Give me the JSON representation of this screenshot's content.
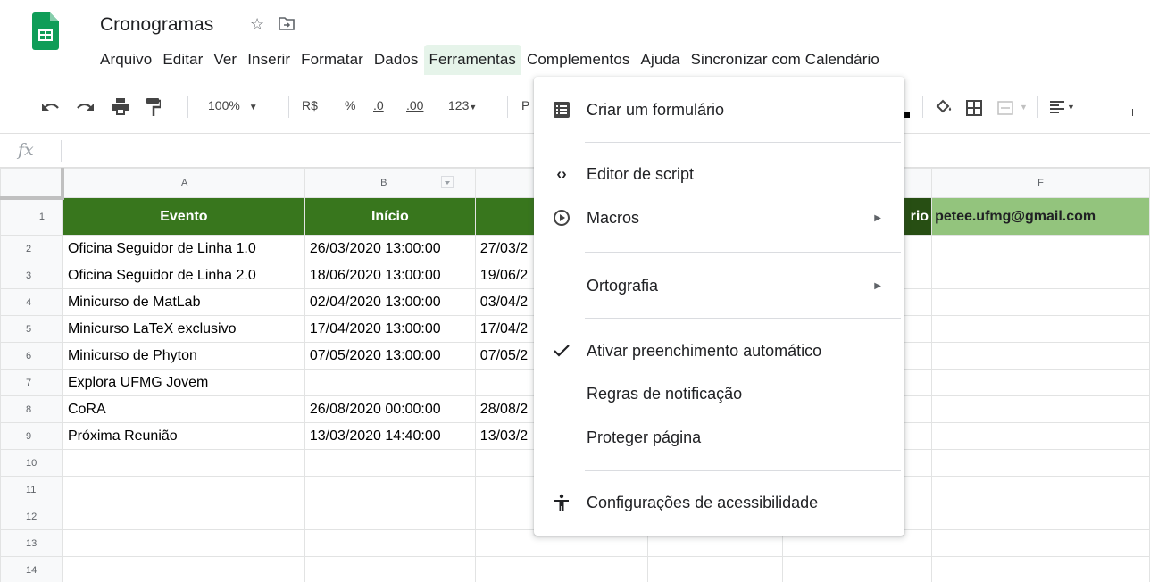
{
  "app": {
    "doc_title": "Cronogramas",
    "brand_color": "#0f9d58"
  },
  "menubar": [
    "Arquivo",
    "Editar",
    "Ver",
    "Inserir",
    "Formatar",
    "Dados",
    "Ferramentas",
    "Complementos",
    "Ajuda",
    "Sincronizar com Calendário"
  ],
  "toolbar": {
    "zoom": "100%",
    "currency": "R$",
    "percent": "%",
    "dec_less": ".0",
    "dec_more": ".00",
    "format_more": "123",
    "font_partial": "P"
  },
  "formula_bar": {
    "fx": "fx",
    "value": ""
  },
  "grid": {
    "columns": [
      "A",
      "B",
      "",
      "",
      "",
      "F"
    ],
    "rows": [
      {
        "num": "1",
        "cells": [
          "Evento",
          "Início",
          "",
          "",
          "rio",
          "petee.ufmg@gmail.com"
        ]
      },
      {
        "num": "2",
        "cells": [
          "Oficina Seguidor de Linha 1.0",
          "26/03/2020 13:00:00",
          "27/03/2",
          "",
          "",
          ""
        ]
      },
      {
        "num": "3",
        "cells": [
          "Oficina Seguidor de Linha 2.0",
          "18/06/2020 13:00:00",
          "19/06/2",
          "",
          "",
          ""
        ]
      },
      {
        "num": "4",
        "cells": [
          "Minicurso de MatLab",
          "02/04/2020 13:00:00",
          "03/04/2",
          "",
          "",
          ""
        ]
      },
      {
        "num": "5",
        "cells": [
          "Minicurso LaTeX exclusivo",
          "17/04/2020 13:00:00",
          "17/04/2",
          "",
          "",
          ""
        ]
      },
      {
        "num": "6",
        "cells": [
          "Minicurso de Phyton",
          "07/05/2020 13:00:00",
          "07/05/2",
          "",
          "",
          ""
        ]
      },
      {
        "num": "7",
        "cells": [
          "Explora UFMG Jovem",
          "",
          "",
          "",
          "",
          ""
        ]
      },
      {
        "num": "8",
        "cells": [
          "CoRA",
          "26/08/2020 00:00:00",
          "28/08/2",
          "",
          "",
          ""
        ]
      },
      {
        "num": "9",
        "cells": [
          "Próxima Reunião",
          "13/03/2020 14:40:00",
          "13/03/2",
          "",
          "",
          ""
        ]
      },
      {
        "num": "10",
        "cells": [
          "",
          "",
          "",
          "",
          "",
          ""
        ]
      },
      {
        "num": "11",
        "cells": [
          "",
          "",
          "",
          "",
          "",
          ""
        ]
      },
      {
        "num": "12",
        "cells": [
          "",
          "",
          "",
          "",
          "",
          ""
        ]
      },
      {
        "num": "13",
        "cells": [
          "",
          "",
          "",
          "",
          "",
          ""
        ]
      },
      {
        "num": "14",
        "cells": [
          "",
          "",
          "",
          "",
          "",
          ""
        ]
      }
    ]
  },
  "dropdown": {
    "items": {
      "criar_formulario": "Criar um formulário",
      "editor_script": "Editor de script",
      "macros": "Macros",
      "ortografia": "Ortografia",
      "preenchimento": "Ativar preenchimento automático",
      "regras": "Regras de notificação",
      "proteger": "Proteger página",
      "acessibilidade": "Configurações de acessibilidade"
    }
  }
}
